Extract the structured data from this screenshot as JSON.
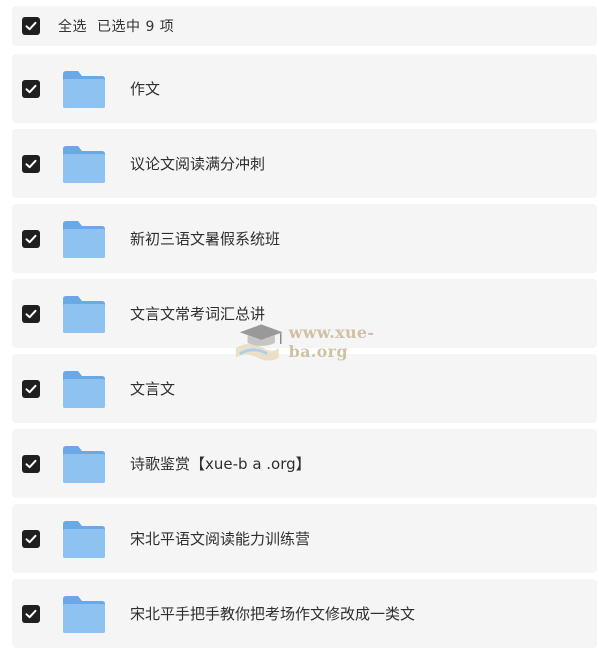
{
  "header": {
    "select_all_label": "全选",
    "selected_count_text": "已选中 9 项",
    "checked": true
  },
  "items": [
    {
      "name": "作文",
      "type": "folder",
      "checked": true
    },
    {
      "name": "议论文阅读满分冲刺",
      "type": "folder",
      "checked": true
    },
    {
      "name": "新初三语文暑假系统班",
      "type": "folder",
      "checked": true
    },
    {
      "name": "文言文常考词汇总讲",
      "type": "folder",
      "checked": true
    },
    {
      "name": "文言文",
      "type": "folder",
      "checked": true
    },
    {
      "name": "诗歌鉴赏【xue-b a .org】",
      "type": "folder",
      "checked": true
    },
    {
      "name": "宋北平语文阅读能力训练营",
      "type": "folder",
      "checked": true
    },
    {
      "name": "宋北平手把手教你把考场作文修改成一类文",
      "type": "folder",
      "checked": true
    }
  ],
  "icons": {
    "checkbox": "checkbox-checked-icon",
    "folder": "folder-icon",
    "watermark_logo": "graduation-cap-icon"
  },
  "colors": {
    "checkbox": "#1f1f1f",
    "row_background": "#f5f5f6",
    "folder": "#7fb6ea",
    "watermark": "#c9b896"
  },
  "watermark": {
    "text": "www.xue-ba.org"
  }
}
